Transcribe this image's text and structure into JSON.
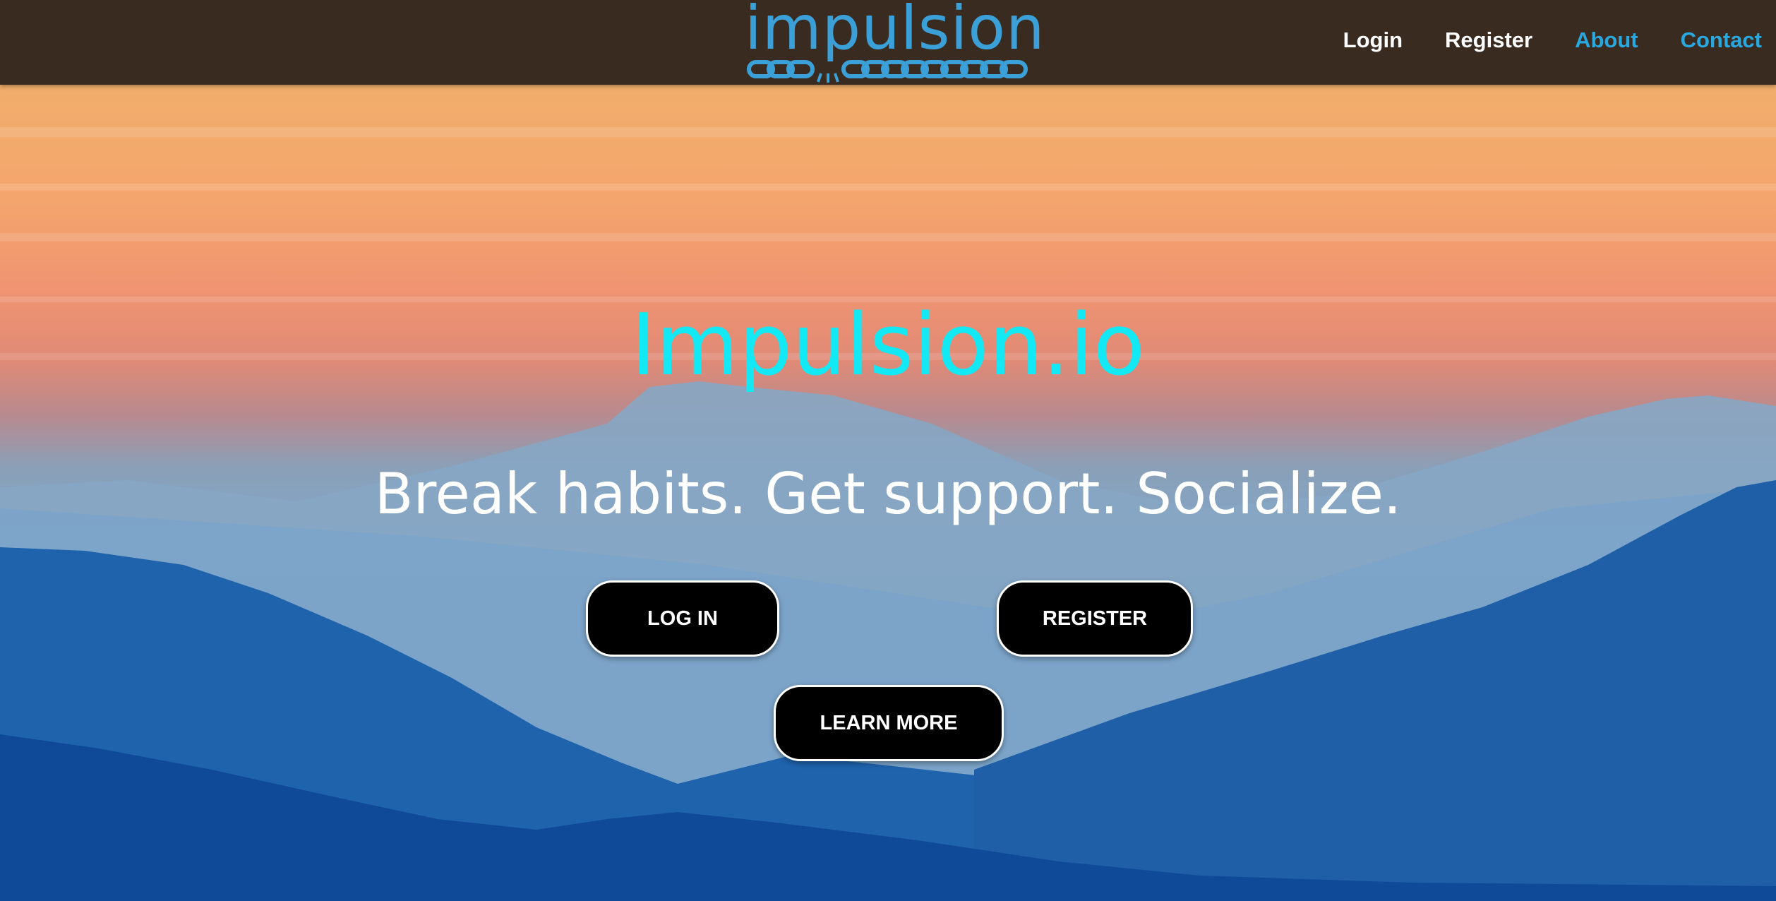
{
  "brand": {
    "logo_text": "impulsion",
    "logo_color": "#3ba0d8"
  },
  "nav": {
    "items": [
      {
        "label": "Login",
        "color": "#ffffff"
      },
      {
        "label": "Register",
        "color": "#ffffff"
      },
      {
        "label": "About",
        "color": "#29a8e0"
      },
      {
        "label": "Contact",
        "color": "#29a8e0"
      }
    ]
  },
  "hero": {
    "title": "Impulsion.io",
    "title_color": "#13e8f5",
    "tagline": "Break habits. Get support. Socialize.",
    "buttons": {
      "login": "LOG IN",
      "register": "REGISTER",
      "learn_more": "LEARN MORE"
    }
  },
  "icons": {
    "logo_chain": "broken-chain-icon"
  }
}
